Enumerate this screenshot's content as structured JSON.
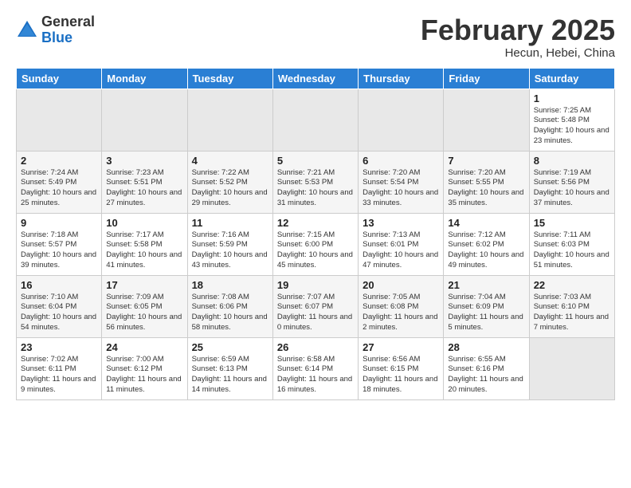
{
  "logo": {
    "general": "General",
    "blue": "Blue"
  },
  "header": {
    "month": "February 2025",
    "location": "Hecun, Hebei, China"
  },
  "weekdays": [
    "Sunday",
    "Monday",
    "Tuesday",
    "Wednesday",
    "Thursday",
    "Friday",
    "Saturday"
  ],
  "weeks": [
    [
      {
        "day": "",
        "info": ""
      },
      {
        "day": "",
        "info": ""
      },
      {
        "day": "",
        "info": ""
      },
      {
        "day": "",
        "info": ""
      },
      {
        "day": "",
        "info": ""
      },
      {
        "day": "",
        "info": ""
      },
      {
        "day": "1",
        "info": "Sunrise: 7:25 AM\nSunset: 5:48 PM\nDaylight: 10 hours and 23 minutes."
      }
    ],
    [
      {
        "day": "2",
        "info": "Sunrise: 7:24 AM\nSunset: 5:49 PM\nDaylight: 10 hours and 25 minutes."
      },
      {
        "day": "3",
        "info": "Sunrise: 7:23 AM\nSunset: 5:51 PM\nDaylight: 10 hours and 27 minutes."
      },
      {
        "day": "4",
        "info": "Sunrise: 7:22 AM\nSunset: 5:52 PM\nDaylight: 10 hours and 29 minutes."
      },
      {
        "day": "5",
        "info": "Sunrise: 7:21 AM\nSunset: 5:53 PM\nDaylight: 10 hours and 31 minutes."
      },
      {
        "day": "6",
        "info": "Sunrise: 7:20 AM\nSunset: 5:54 PM\nDaylight: 10 hours and 33 minutes."
      },
      {
        "day": "7",
        "info": "Sunrise: 7:20 AM\nSunset: 5:55 PM\nDaylight: 10 hours and 35 minutes."
      },
      {
        "day": "8",
        "info": "Sunrise: 7:19 AM\nSunset: 5:56 PM\nDaylight: 10 hours and 37 minutes."
      }
    ],
    [
      {
        "day": "9",
        "info": "Sunrise: 7:18 AM\nSunset: 5:57 PM\nDaylight: 10 hours and 39 minutes."
      },
      {
        "day": "10",
        "info": "Sunrise: 7:17 AM\nSunset: 5:58 PM\nDaylight: 10 hours and 41 minutes."
      },
      {
        "day": "11",
        "info": "Sunrise: 7:16 AM\nSunset: 5:59 PM\nDaylight: 10 hours and 43 minutes."
      },
      {
        "day": "12",
        "info": "Sunrise: 7:15 AM\nSunset: 6:00 PM\nDaylight: 10 hours and 45 minutes."
      },
      {
        "day": "13",
        "info": "Sunrise: 7:13 AM\nSunset: 6:01 PM\nDaylight: 10 hours and 47 minutes."
      },
      {
        "day": "14",
        "info": "Sunrise: 7:12 AM\nSunset: 6:02 PM\nDaylight: 10 hours and 49 minutes."
      },
      {
        "day": "15",
        "info": "Sunrise: 7:11 AM\nSunset: 6:03 PM\nDaylight: 10 hours and 51 minutes."
      }
    ],
    [
      {
        "day": "16",
        "info": "Sunrise: 7:10 AM\nSunset: 6:04 PM\nDaylight: 10 hours and 54 minutes."
      },
      {
        "day": "17",
        "info": "Sunrise: 7:09 AM\nSunset: 6:05 PM\nDaylight: 10 hours and 56 minutes."
      },
      {
        "day": "18",
        "info": "Sunrise: 7:08 AM\nSunset: 6:06 PM\nDaylight: 10 hours and 58 minutes."
      },
      {
        "day": "19",
        "info": "Sunrise: 7:07 AM\nSunset: 6:07 PM\nDaylight: 11 hours and 0 minutes."
      },
      {
        "day": "20",
        "info": "Sunrise: 7:05 AM\nSunset: 6:08 PM\nDaylight: 11 hours and 2 minutes."
      },
      {
        "day": "21",
        "info": "Sunrise: 7:04 AM\nSunset: 6:09 PM\nDaylight: 11 hours and 5 minutes."
      },
      {
        "day": "22",
        "info": "Sunrise: 7:03 AM\nSunset: 6:10 PM\nDaylight: 11 hours and 7 minutes."
      }
    ],
    [
      {
        "day": "23",
        "info": "Sunrise: 7:02 AM\nSunset: 6:11 PM\nDaylight: 11 hours and 9 minutes."
      },
      {
        "day": "24",
        "info": "Sunrise: 7:00 AM\nSunset: 6:12 PM\nDaylight: 11 hours and 11 minutes."
      },
      {
        "day": "25",
        "info": "Sunrise: 6:59 AM\nSunset: 6:13 PM\nDaylight: 11 hours and 14 minutes."
      },
      {
        "day": "26",
        "info": "Sunrise: 6:58 AM\nSunset: 6:14 PM\nDaylight: 11 hours and 16 minutes."
      },
      {
        "day": "27",
        "info": "Sunrise: 6:56 AM\nSunset: 6:15 PM\nDaylight: 11 hours and 18 minutes."
      },
      {
        "day": "28",
        "info": "Sunrise: 6:55 AM\nSunset: 6:16 PM\nDaylight: 11 hours and 20 minutes."
      },
      {
        "day": "",
        "info": ""
      }
    ]
  ]
}
